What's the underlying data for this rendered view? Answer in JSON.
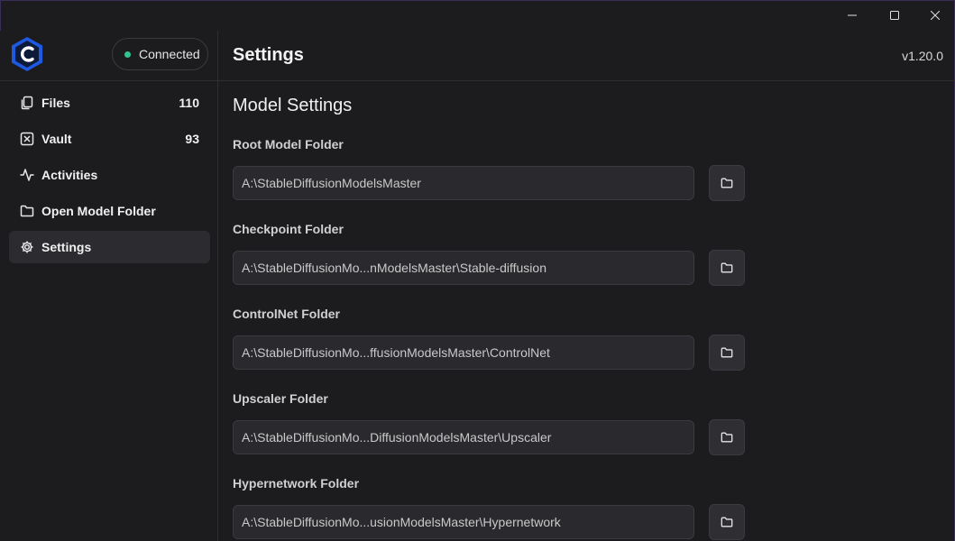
{
  "window": {
    "controls": [
      {
        "name": "minimize-icon"
      },
      {
        "name": "maximize-icon"
      },
      {
        "name": "close-icon"
      }
    ]
  },
  "sidebar": {
    "logo_icon": "app-logo-hexagon-c",
    "connection": {
      "label": "Connected",
      "color": "#34c38f"
    },
    "items": [
      {
        "label": "Files",
        "count": "110",
        "icon": "files-icon"
      },
      {
        "label": "Vault",
        "count": "93",
        "icon": "vault-icon"
      },
      {
        "label": "Activities",
        "count": "",
        "icon": "activity-icon"
      },
      {
        "label": "Open Model Folder",
        "count": "",
        "icon": "folder-icon"
      },
      {
        "label": "Settings",
        "count": "",
        "icon": "gear-icon",
        "active": true
      }
    ]
  },
  "header": {
    "title": "Settings",
    "version": "v1.20.0"
  },
  "main": {
    "section_title": "Model Settings",
    "fields": [
      {
        "label": "Root Model Folder",
        "value": "A:\\StableDiffusionModelsMaster"
      },
      {
        "label": "Checkpoint Folder",
        "value": "A:\\StableDiffusionMo...nModelsMaster\\Stable-diffusion"
      },
      {
        "label": "ControlNet Folder",
        "value": "A:\\StableDiffusionMo...ffusionModelsMaster\\ControlNet"
      },
      {
        "label": "Upscaler Folder",
        "value": "A:\\StableDiffusionMo...DiffusionModelsMaster\\Upscaler"
      },
      {
        "label": "Hypernetwork Folder",
        "value": "A:\\StableDiffusionMo...usionModelsMaster\\Hypernetwork"
      }
    ]
  },
  "colors": {
    "background": "#1c1c1f",
    "accent": "#1e5ae0",
    "status": "#34c38f"
  }
}
